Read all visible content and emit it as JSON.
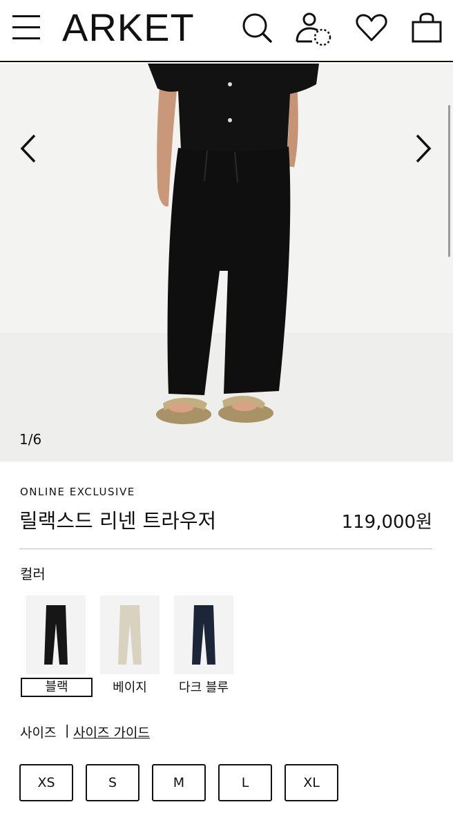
{
  "header": {
    "logo": "ARKET",
    "icons": [
      "menu-icon",
      "search-icon",
      "account-icon",
      "wishlist-icon",
      "bag-icon"
    ]
  },
  "gallery": {
    "counter": "1/6",
    "prev_icon": "chevron-left-icon",
    "next_icon": "chevron-right-icon"
  },
  "product": {
    "badge": "ONLINE EXCLUSIVE",
    "title": "릴랙스드 리넨 트라우저",
    "price": "119,000원"
  },
  "colors": {
    "label": "컬러",
    "options": [
      {
        "name": "블랙",
        "hex": "#161616",
        "selected": true
      },
      {
        "name": "베이지",
        "hex": "#d9d2c1",
        "selected": false
      },
      {
        "name": "다크 블루",
        "hex": "#1d2638",
        "selected": false
      }
    ]
  },
  "sizes": {
    "label": "사이즈",
    "separator": "|",
    "guide_link": "사이즈 가이드",
    "options": [
      "XS",
      "S",
      "M",
      "L",
      "XL"
    ]
  }
}
